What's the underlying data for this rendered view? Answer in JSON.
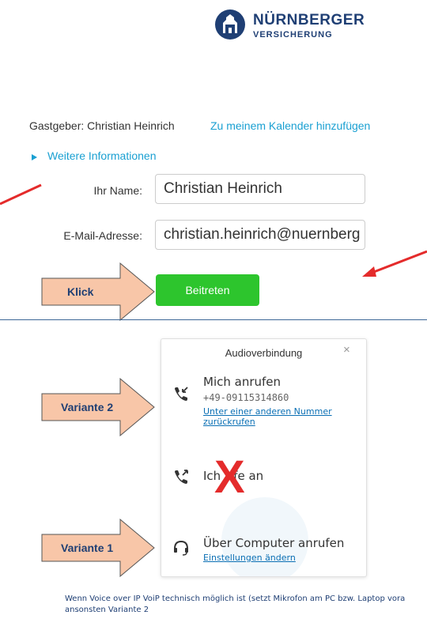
{
  "logo": {
    "name": "NÜRNBERGER",
    "sub": "VERSICHERUNG"
  },
  "meeting": {
    "host_text": "Gastgeber: Christian Heinrich",
    "calendar_link": "Zu meinem Kalender hinzufügen",
    "more_info": "Weitere Informationen"
  },
  "form": {
    "name_label": "Ihr Name:",
    "name_value": "Christian Heinrich",
    "email_label": "E-Mail-Adresse:",
    "email_value": "christian.heinrich@nuernberg",
    "join_button": "Beitreten"
  },
  "annotations": {
    "click_label": "Klick",
    "variant2_label": "Variante 2",
    "variant1_label": "Variante 1",
    "x_mark": "X",
    "footer_line1": "Wenn Voice over IP VoiP technisch möglich ist (setzt Mikrofon am PC bzw. Laptop vora",
    "footer_line2": "ansonsten Variante 2"
  },
  "audio_dialog": {
    "title": "Audioverbindung",
    "close_glyph": "×",
    "options": [
      {
        "title": "Mich anrufen",
        "number": "+49-09115314860",
        "link": "Unter einer anderen Nummer zurückrufen",
        "icon": "phone-incoming-icon"
      },
      {
        "title_left": "Ich",
        "title_right": "fe an",
        "icon": "phone-outgoing-icon"
      },
      {
        "title": "Über Computer anrufen",
        "link": "Einstellungen ändern",
        "icon": "headset-icon"
      }
    ]
  },
  "colors": {
    "brand": "#1f3f74",
    "link": "#1aa0d2",
    "join": "#2dc52d",
    "annotation_arrow": "#f8c6a8",
    "annotation_red": "#e42b2b"
  }
}
